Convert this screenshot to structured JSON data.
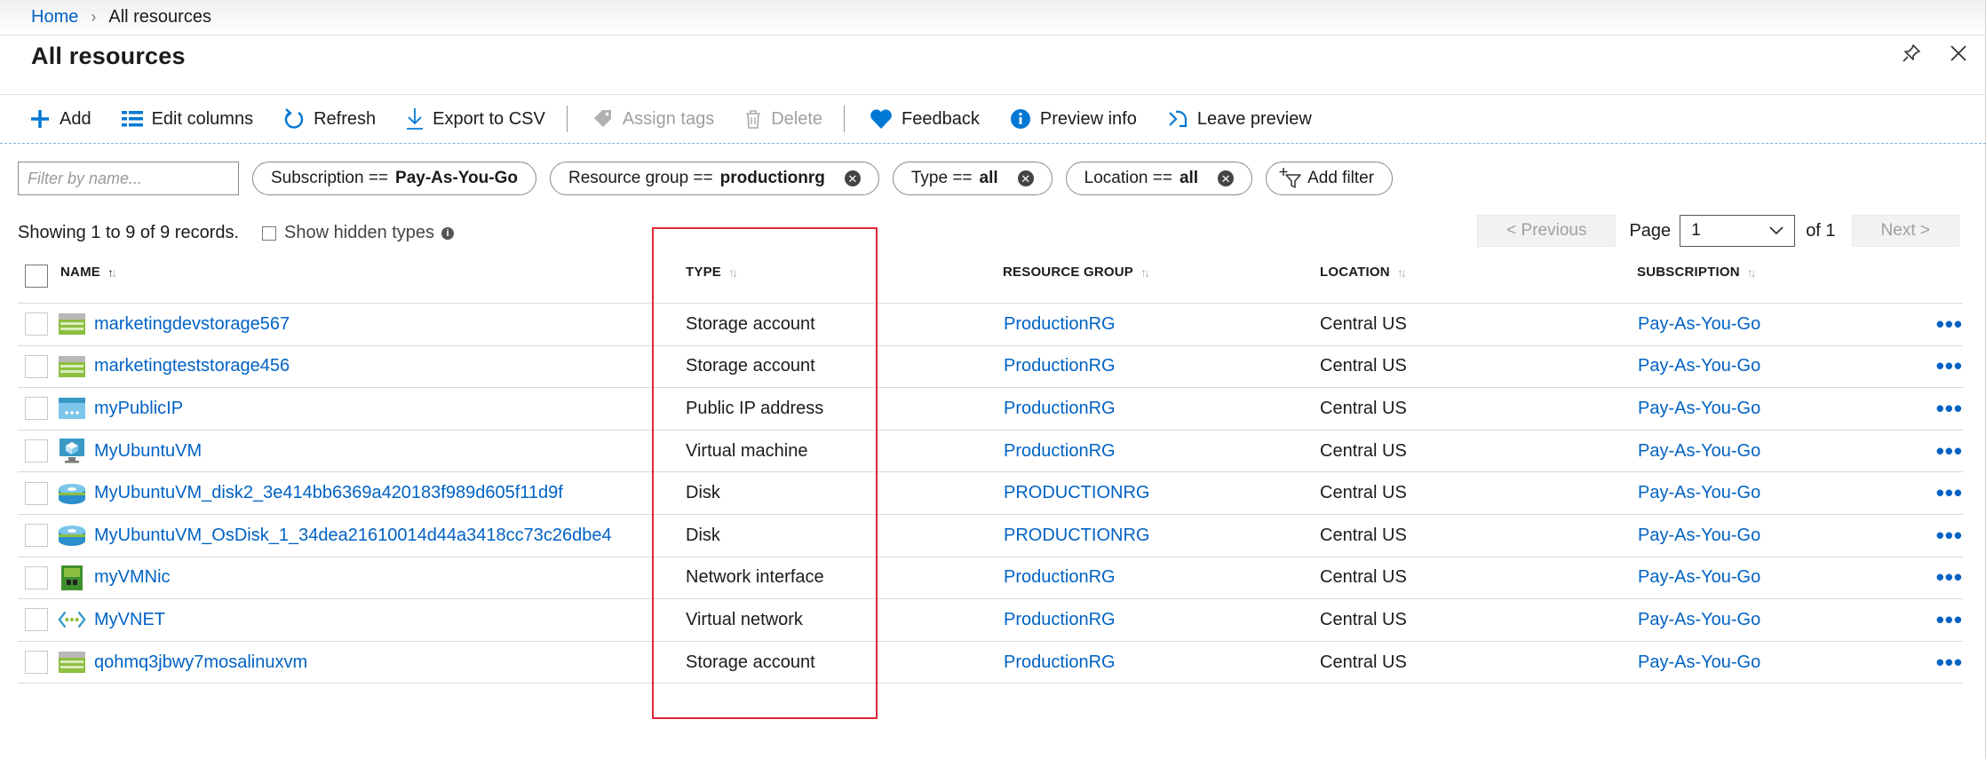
{
  "breadcrumb": {
    "home": "Home",
    "current": "All resources"
  },
  "page": {
    "title": "All resources"
  },
  "icons": {
    "pin": "pin-icon",
    "close": "close-icon"
  },
  "toolbar": {
    "add": "Add",
    "edit_columns": "Edit columns",
    "refresh": "Refresh",
    "export": "Export to CSV",
    "assign_tags": "Assign tags",
    "delete": "Delete",
    "feedback": "Feedback",
    "preview_info": "Preview info",
    "leave_preview": "Leave preview"
  },
  "filters": {
    "placeholder": "Filter by name...",
    "subscription": {
      "label": "Subscription ==",
      "value": "Pay-As-You-Go"
    },
    "resource_group": {
      "label": "Resource group ==",
      "value": "productionrg"
    },
    "type": {
      "label": "Type ==",
      "value": "all"
    },
    "location": {
      "label": "Location ==",
      "value": "all"
    },
    "add_filter": "Add filter"
  },
  "records": {
    "summary": "Showing 1 to 9 of 9 records.",
    "show_hidden": "Show hidden types"
  },
  "pager": {
    "previous": "< Previous",
    "page_label": "Page",
    "page_value": "1",
    "of": "of 1",
    "next": "Next >"
  },
  "columns": {
    "name": "NAME",
    "type": "TYPE",
    "resource_group": "RESOURCE GROUP",
    "location": "LOCATION",
    "subscription": "SUBSCRIPTION"
  },
  "rows": [
    {
      "name": "marketingdevstorage567",
      "type": "Storage account",
      "resource_group": "ProductionRG",
      "location": "Central US",
      "subscription": "Pay-As-You-Go",
      "icon": "storage-account-icon"
    },
    {
      "name": "marketingteststorage456",
      "type": "Storage account",
      "resource_group": "ProductionRG",
      "location": "Central US",
      "subscription": "Pay-As-You-Go",
      "icon": "storage-account-icon"
    },
    {
      "name": "myPublicIP",
      "type": "Public IP address",
      "resource_group": "ProductionRG",
      "location": "Central US",
      "subscription": "Pay-As-You-Go",
      "icon": "public-ip-icon"
    },
    {
      "name": "MyUbuntuVM",
      "type": "Virtual machine",
      "resource_group": "ProductionRG",
      "location": "Central US",
      "subscription": "Pay-As-You-Go",
      "icon": "virtual-machine-icon"
    },
    {
      "name": "MyUbuntuVM_disk2_3e414bb6369a420183f989d605f11d9f",
      "type": "Disk",
      "resource_group": "PRODUCTIONRG",
      "location": "Central US",
      "subscription": "Pay-As-You-Go",
      "icon": "disk-icon"
    },
    {
      "name": "MyUbuntuVM_OsDisk_1_34dea21610014d44a3418cc73c26dbe4",
      "type": "Disk",
      "resource_group": "PRODUCTIONRG",
      "location": "Central US",
      "subscription": "Pay-As-You-Go",
      "icon": "disk-icon"
    },
    {
      "name": "myVMNic",
      "type": "Network interface",
      "resource_group": "ProductionRG",
      "location": "Central US",
      "subscription": "Pay-As-You-Go",
      "icon": "network-interface-icon"
    },
    {
      "name": "MyVNET",
      "type": "Virtual network",
      "resource_group": "ProductionRG",
      "location": "Central US",
      "subscription": "Pay-As-You-Go",
      "icon": "virtual-network-icon"
    },
    {
      "name": "qohmq3jbwy7mosalinuxvm",
      "type": "Storage account",
      "resource_group": "ProductionRG",
      "location": "Central US",
      "subscription": "Pay-As-You-Go",
      "icon": "storage-account-icon"
    }
  ],
  "colors": {
    "link": "#0062c4",
    "highlight": "#e0263a",
    "heart": "#0078d4"
  }
}
